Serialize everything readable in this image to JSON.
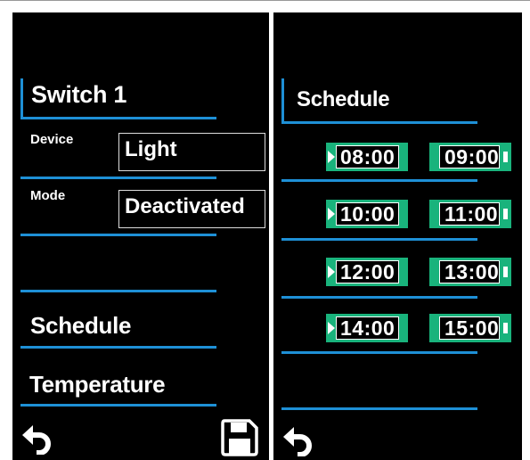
{
  "left_panel": {
    "title": "Switch 1",
    "device": {
      "label": "Device",
      "value": "Light"
    },
    "mode": {
      "label": "Mode",
      "value": "Deactivated"
    },
    "menu": [
      {
        "label": "Schedule"
      },
      {
        "label": "Temperature"
      }
    ],
    "back_icon": "back-arrow-icon",
    "save_icon": "floppy-disk-save-icon"
  },
  "right_panel": {
    "title": "Schedule",
    "slots": [
      {
        "start": "08:00",
        "end": "09:00"
      },
      {
        "start": "10:00",
        "end": "11:00"
      },
      {
        "start": "12:00",
        "end": "13:00"
      },
      {
        "start": "14:00",
        "end": "15:00"
      }
    ],
    "back_icon": "back-arrow-icon"
  },
  "colors": {
    "accent": "#1e90d6",
    "time_field": "#19b37c",
    "background": "#000000"
  }
}
